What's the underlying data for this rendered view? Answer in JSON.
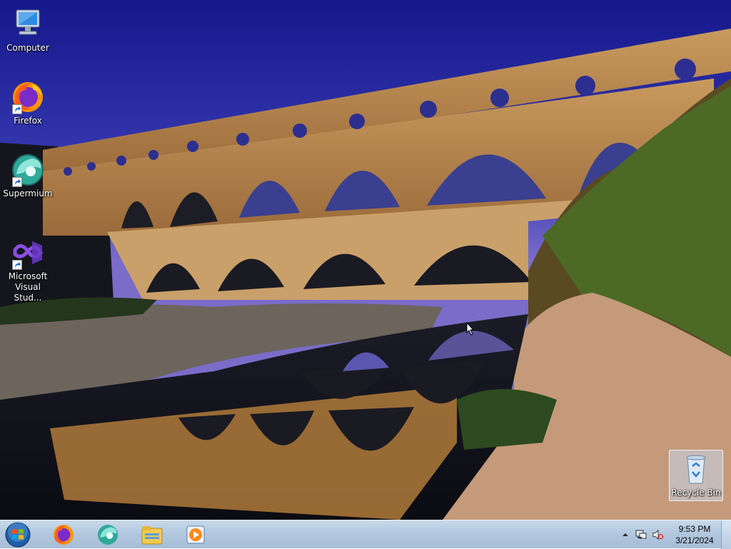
{
  "desktop": {
    "icons": [
      {
        "label": "Computer",
        "icon": "computer-icon"
      },
      {
        "label": "Firefox",
        "icon": "firefox-icon"
      },
      {
        "label": "Supermium",
        "icon": "supermium-icon"
      },
      {
        "label_line1": "Microsoft",
        "label_line2": "Visual Stud...",
        "icon": "visual-studio-icon"
      },
      {
        "label": "Recycle Bin",
        "icon": "recycle-bin-icon"
      }
    ],
    "wallpaper": "pont-du-gard-aqueduct"
  },
  "taskbar": {
    "start": "windows-start-orb",
    "pinned": [
      "firefox-icon",
      "supermium-icon",
      "file-explorer-icon",
      "media-player-icon"
    ],
    "tray_icons": [
      "show-hidden-icons-arrow",
      "network-icon",
      "volume-muted-icon"
    ],
    "clock": {
      "time": "9:53 PM",
      "date": "3/21/2024"
    }
  },
  "colors": {
    "sky_top": "#1b1f8a",
    "sky_bottom": "#6d63c4",
    "stone": "#b98952",
    "taskbar": "#b2c8df"
  }
}
